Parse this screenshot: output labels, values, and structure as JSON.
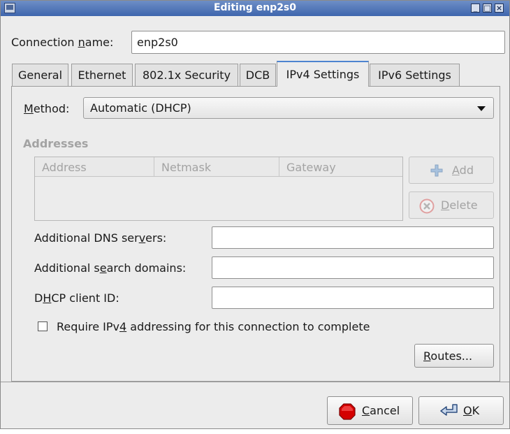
{
  "window": {
    "title": "Editing enp2s0",
    "controls": [
      "minimize",
      "maximize",
      "close"
    ]
  },
  "connection": {
    "label_pre": "Connection ",
    "label_key": "n",
    "label_post": "ame:",
    "value": "enp2s0"
  },
  "tabs": [
    {
      "label": "General"
    },
    {
      "label": "Ethernet"
    },
    {
      "label": "802.1x Security"
    },
    {
      "label": "DCB"
    },
    {
      "label": "IPv4 Settings",
      "active": true
    },
    {
      "label": "IPv6 Settings"
    }
  ],
  "method": {
    "label_key": "M",
    "label_post": "ethod:",
    "value": "Automatic (DHCP)"
  },
  "addresses": {
    "heading": "Addresses",
    "columns": [
      "Address",
      "Netmask",
      "Gateway"
    ],
    "rows": [],
    "add_icon": "plus-icon",
    "add_key": "A",
    "add_post": "dd",
    "delete_icon": "delete-circle-icon",
    "delete_key": "D",
    "delete_post": "elete"
  },
  "dns": {
    "label_pre": "Additional DNS ser",
    "label_key": "v",
    "label_post": "ers:",
    "value": ""
  },
  "search": {
    "label_pre": "Additional s",
    "label_key": "e",
    "label_post": "arch domains:",
    "value": ""
  },
  "dhcp": {
    "label_pre": "D",
    "label_key": "H",
    "label_post": "CP client ID:",
    "value": ""
  },
  "require": {
    "label_pre": "Require IPv",
    "label_key": "4",
    "label_post": " addressing for this connection to complete",
    "checked": false
  },
  "routes": {
    "label_key": "R",
    "label_post": "outes..."
  },
  "footer": {
    "cancel_icon": "stop-icon",
    "cancel_key": "C",
    "cancel_post": "ancel",
    "ok_icon": "enter-arrow-icon",
    "ok_key": "O",
    "ok_post": "K"
  },
  "colors": {
    "titlebar": "#3f66ad",
    "active_tab": "#4d84d0",
    "stop_red": "#d40000"
  }
}
